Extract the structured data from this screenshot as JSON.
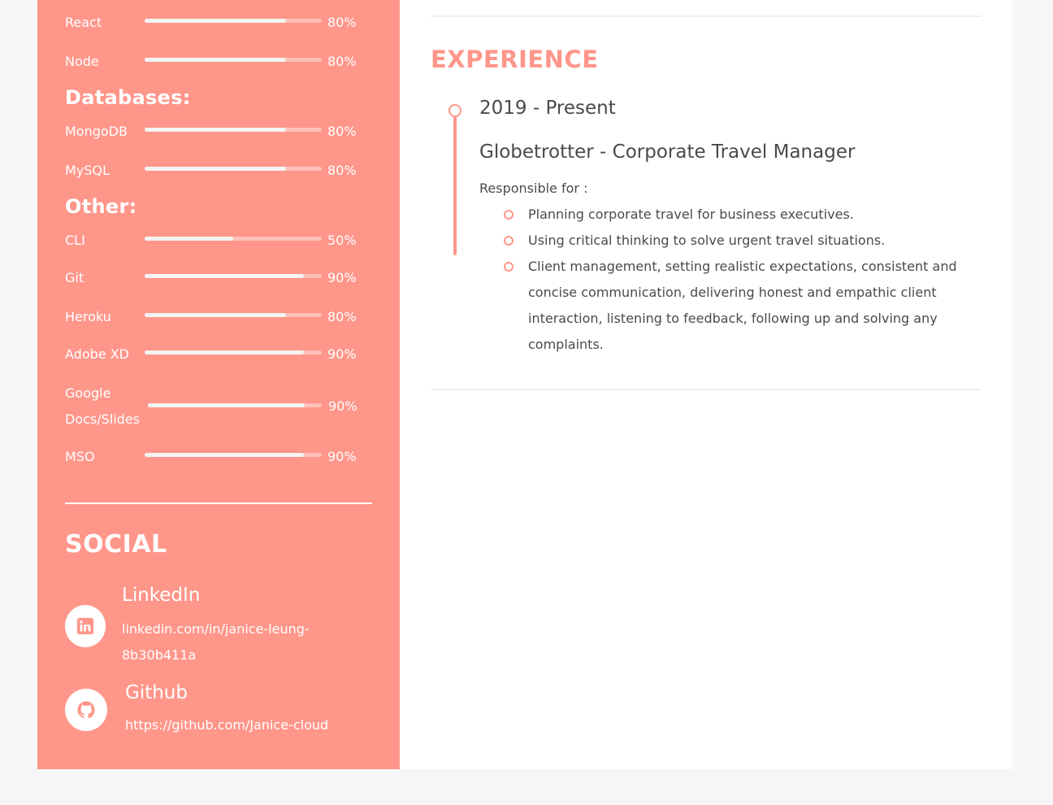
{
  "sidebar": {
    "skills_top": [
      {
        "name": "React",
        "percent_label": "80%",
        "level": 0.8
      },
      {
        "name": "Node",
        "percent_label": "80%",
        "level": 0.8
      }
    ],
    "databases": {
      "heading": "Databases:",
      "items": [
        {
          "name": "MongoDB",
          "percent_label": "80%",
          "level": 0.8
        },
        {
          "name": "MySQL",
          "percent_label": "80%",
          "level": 0.8
        }
      ]
    },
    "other": {
      "heading": "Other:",
      "items": [
        {
          "name": "CLI",
          "percent_label": "50%",
          "level": 0.5
        },
        {
          "name": "Git",
          "percent_label": "90%",
          "level": 0.9
        },
        {
          "name": "Heroku",
          "percent_label": "80%",
          "level": 0.8
        },
        {
          "name": "Adobe XD",
          "percent_label": "90%",
          "level": 0.9
        },
        {
          "name": "Google Docs/Slides",
          "name_line1": "Google",
          "name_line2": "Docs/Slides",
          "percent_label": "90%",
          "level": 0.9
        },
        {
          "name": "MSO",
          "percent_label": "90%",
          "level": 0.9
        }
      ]
    },
    "social": {
      "title": "SOCIAL",
      "linkedin": {
        "name": "LinkedIn",
        "link_line1": "linkedin.com/in/janice-leung-",
        "link_line2": "8b30b411a",
        "icon": "linkedin-icon"
      },
      "github": {
        "name": "Github",
        "link": "https://github.com/Janice-cloud",
        "icon": "github-icon"
      }
    }
  },
  "main": {
    "experience_title": "EXPERIENCE",
    "entries": [
      {
        "date": "2019 - Present",
        "title": "Globetrotter - Corporate Travel Manager",
        "responsible_label": "Responsible for :",
        "bullets": [
          "Planning corporate travel for business executives.",
          "Using critical thinking to solve urgent travel situations.",
          "Client management, setting realistic expectations, consistent and concise communication, delivering honest and empathic client interaction, listening to feedback, following up and solving any complaints."
        ]
      }
    ]
  },
  "colors": {
    "accent": "#ff968a",
    "text": "#4a4a4a",
    "page_bg": "#f6f6f6",
    "track": "#ffc0b9",
    "fill": "#f4f4f4"
  }
}
